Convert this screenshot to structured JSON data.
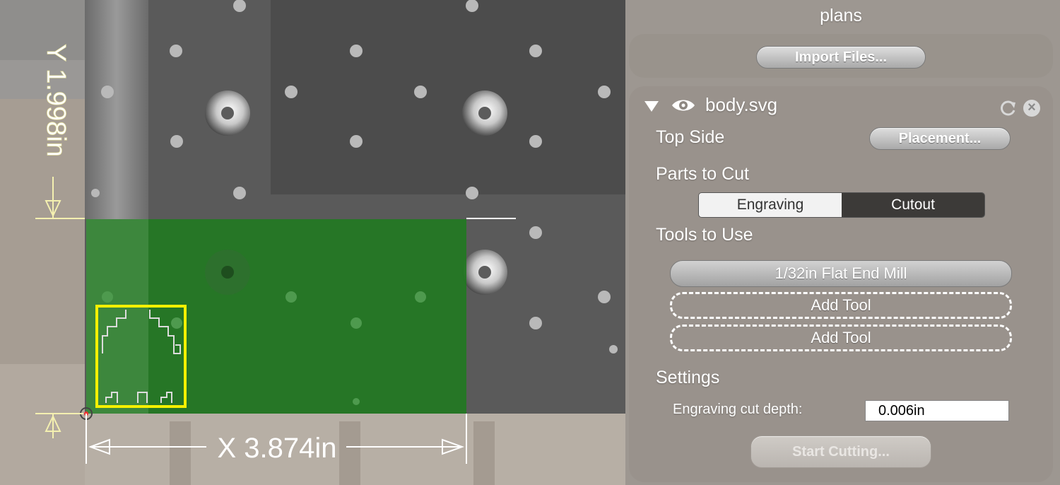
{
  "viewport": {
    "dim_y_label": "Y 1.998in",
    "dim_x_label": "X 3.874in",
    "colors": {
      "stock": "#1e7a1e",
      "selection": "#f5f000",
      "dimension": "#f4f0b0"
    }
  },
  "panel": {
    "title": "plans",
    "import_button": "Import Files...",
    "file": {
      "name": "body.svg",
      "icons": [
        "disclosure-triangle-icon",
        "eye-icon",
        "reload-icon",
        "close-icon"
      ]
    },
    "top_side_label": "Top Side",
    "placement_button": "Placement...",
    "parts_label": "Parts to Cut",
    "parts_segments": {
      "engraving": "Engraving",
      "cutout": "Cutout",
      "selected": "Cutout"
    },
    "tools_label": "Tools to Use",
    "tools": [
      "1/32in Flat End Mill",
      "Add Tool",
      "Add Tool"
    ],
    "settings_label": "Settings",
    "engraving_depth_label": "Engraving cut depth:",
    "engraving_depth_value": "0.006in",
    "start_button": "Start Cutting..."
  }
}
